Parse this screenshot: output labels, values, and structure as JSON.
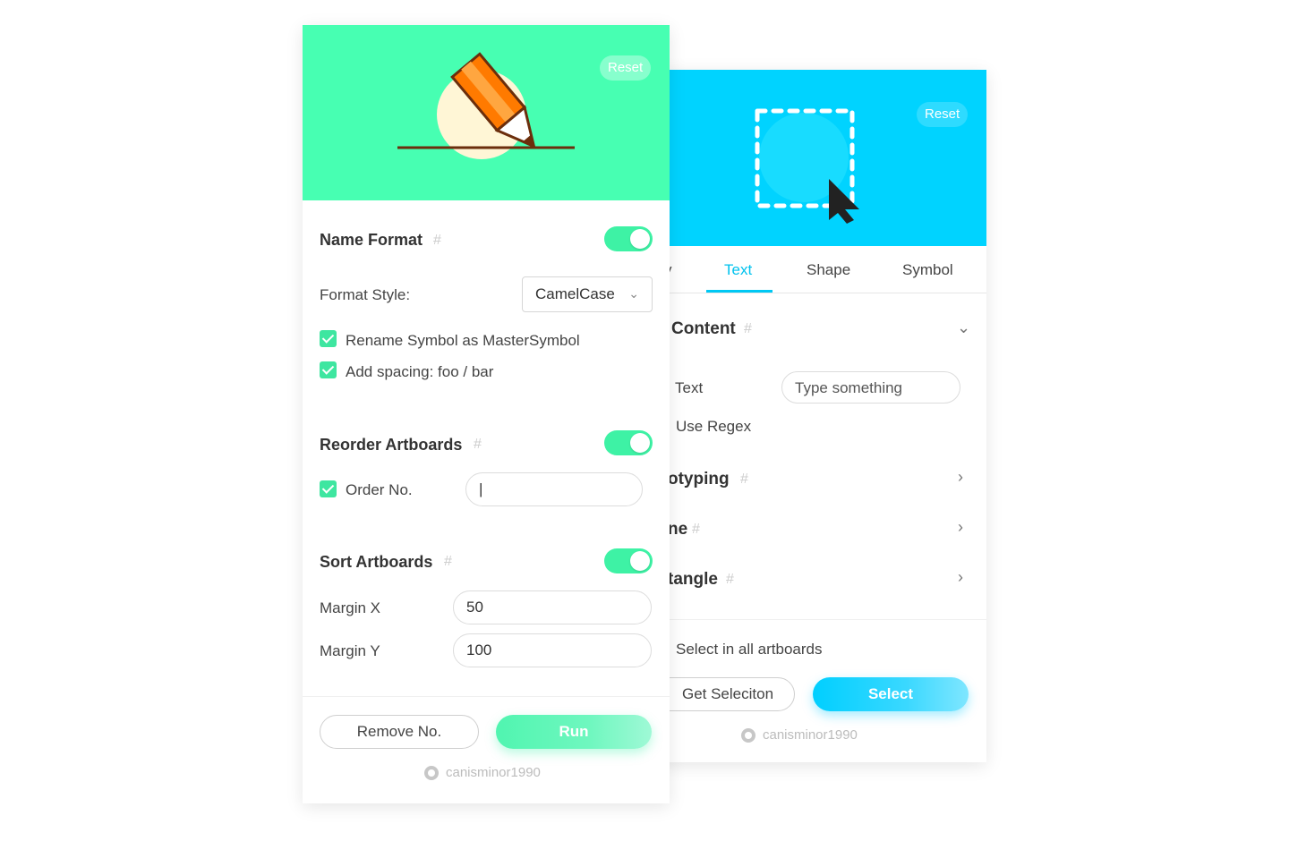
{
  "left_panel": {
    "reset_label": "Reset",
    "name_format": {
      "title": "Name Format",
      "hash": "#",
      "format_style_label": "Format Style:",
      "format_style_value": "CamelCase",
      "rename_symbol_label": "Rename Symbol as MasterSymbol",
      "add_spacing_label": "Add spacing: foo / bar"
    },
    "reorder_artboards": {
      "title": "Reorder Artboards",
      "hash": "#",
      "order_no_label": "Order No.",
      "order_no_value": "|"
    },
    "sort_artboards": {
      "title": "Sort Artboards",
      "hash": "#",
      "margin_x_label": "Margin X",
      "margin_x_value": "50",
      "margin_y_label": "Margin Y",
      "margin_y_value": "100"
    },
    "footer": {
      "remove_label": "Remove No.",
      "run_label": "Run",
      "credit": "canisminor1990"
    }
  },
  "right_panel": {
    "reset_label": "Reset",
    "tabs": [
      {
        "label": "y"
      },
      {
        "label": "Text"
      },
      {
        "label": "Shape"
      },
      {
        "label": "Symbol"
      }
    ],
    "content_section": {
      "title": "Content",
      "hash": "#",
      "text_label": "Text",
      "text_placeholder": "Type something",
      "regex_label": "Use Regex"
    },
    "collapsed_sections": [
      {
        "title": "otyping",
        "hash": "#"
      },
      {
        "title": "ne",
        "hash": "#"
      },
      {
        "title": "tangle",
        "hash": "#"
      }
    ],
    "footer": {
      "select_all_label": "Select in all artboards",
      "get_selection_label": "Get Seleciton",
      "select_label": "Select",
      "credit": "canisminor1990"
    }
  },
  "colors": {
    "green_accent": "#47ffb2",
    "blue_accent": "#00d3ff"
  }
}
